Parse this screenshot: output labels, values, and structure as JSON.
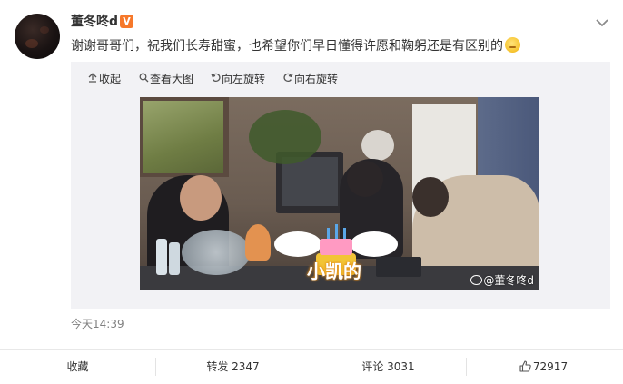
{
  "user": {
    "name": "董冬咚d",
    "verified_badge": "V"
  },
  "post": {
    "text": "谢谢哥哥们，祝我们长寿甜蜜，也希望你们早日懂得许愿和鞠躬还是有区别的",
    "emoji": "smiling-face-emoji",
    "timestamp": "今天14:39"
  },
  "media_toolbar": {
    "collapse_label": "收起",
    "view_large_label": "查看大图",
    "rotate_left_label": "向左旋转",
    "rotate_right_label": "向右旋转"
  },
  "photo": {
    "sticker_text": "小凯的",
    "watermark": "@董冬咚d"
  },
  "actions": {
    "favorite_label": "收藏",
    "repost_label": "转发 2347",
    "comment_label": "评论 3031",
    "like_count": "72917"
  },
  "colors": {
    "verified_badge": "#f6782a",
    "media_background": "#f2f2f5",
    "timestamp": "#808080"
  }
}
